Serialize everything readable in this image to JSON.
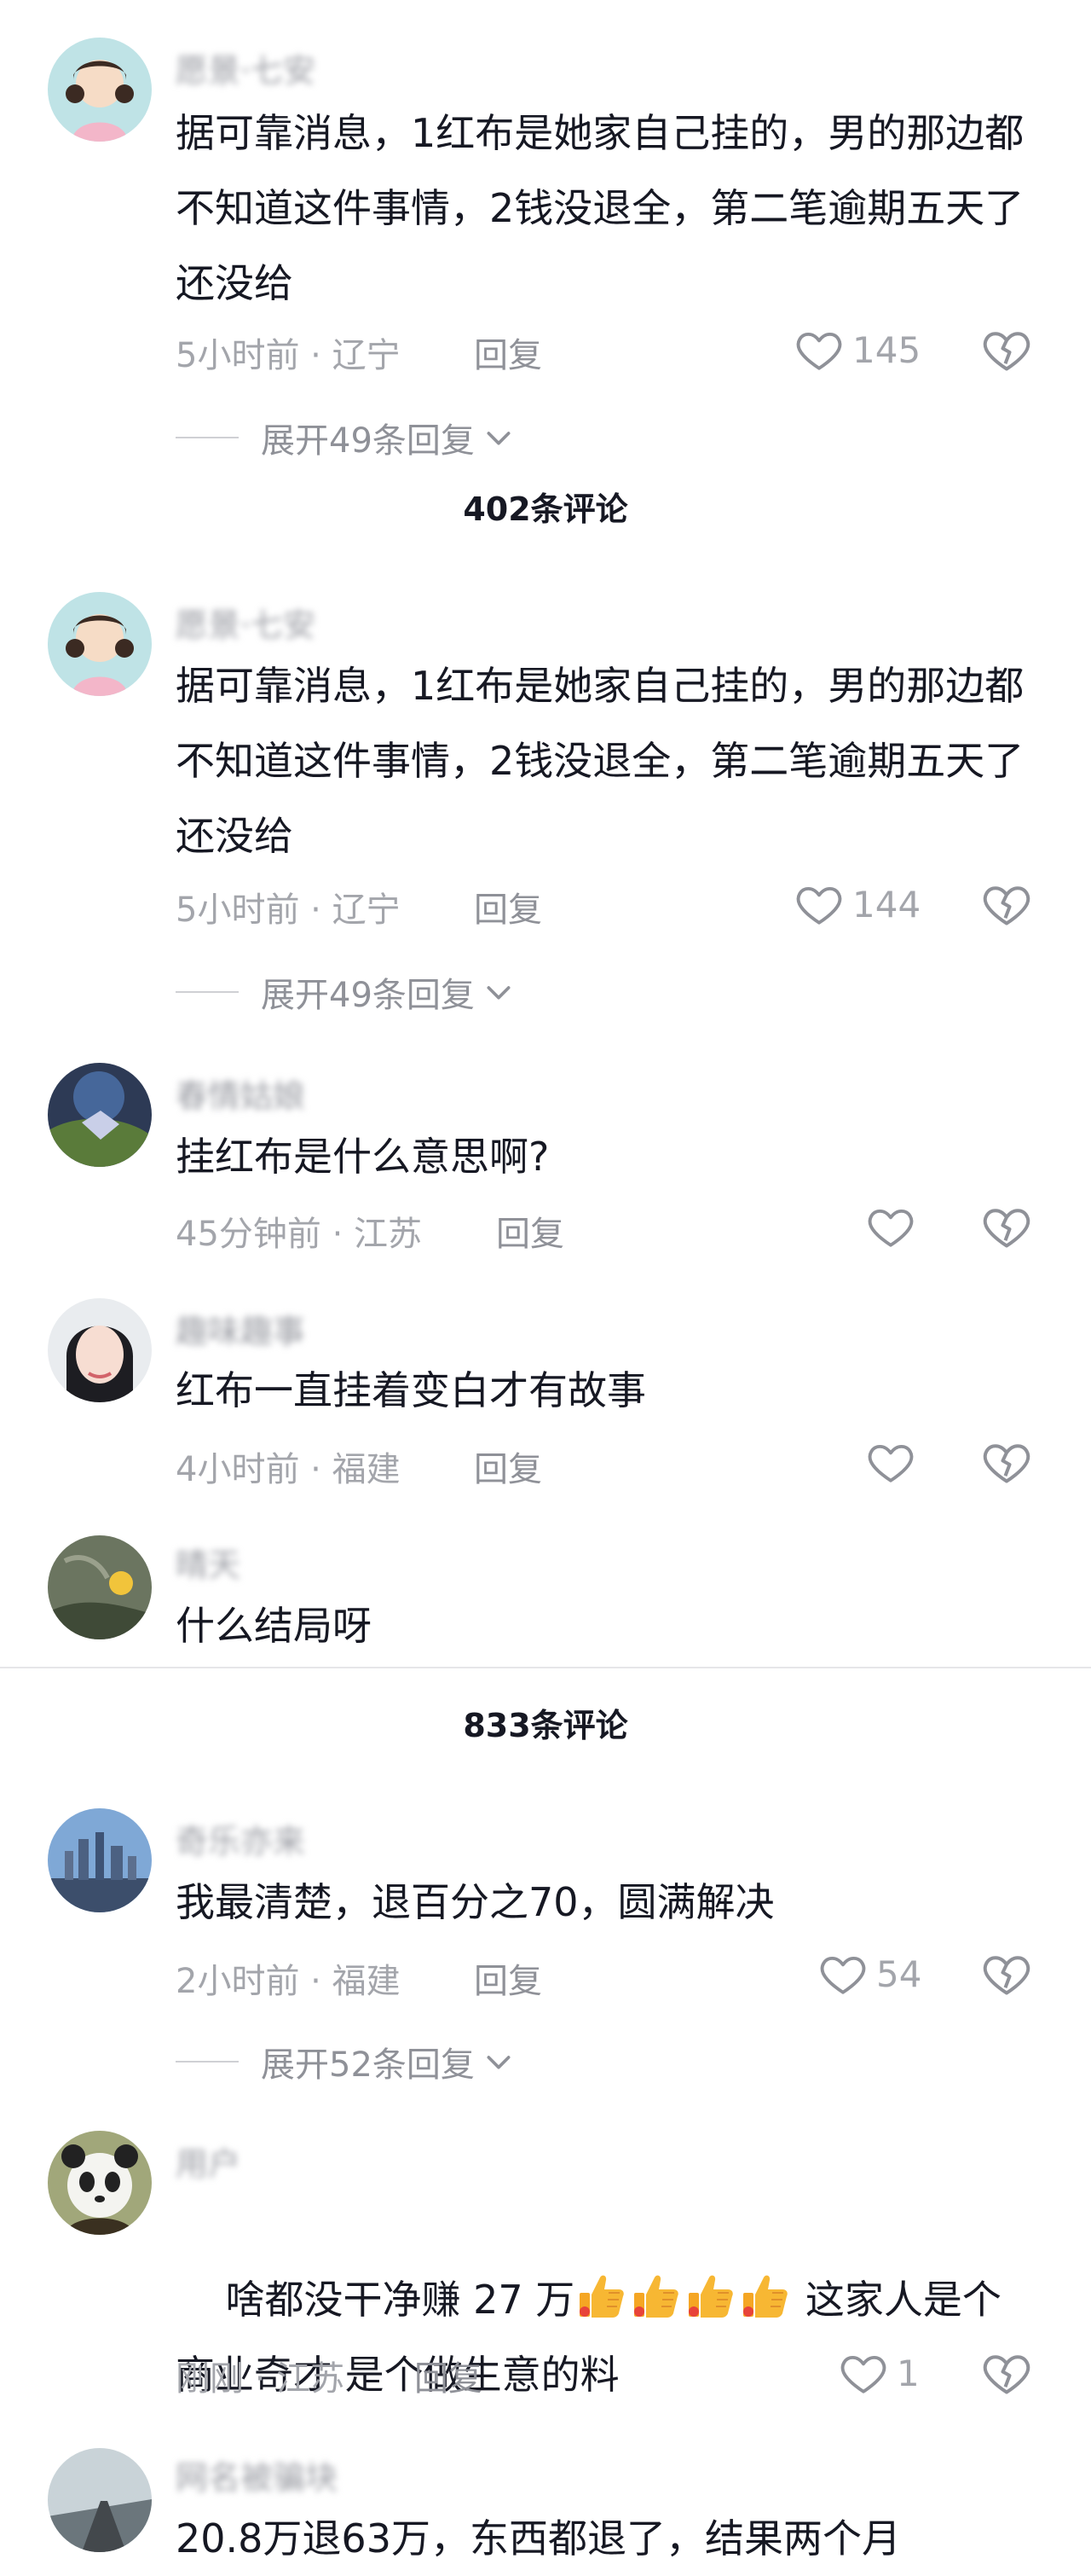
{
  "comment1": {
    "username": "愿景·七安",
    "text": "据可靠消息，1红布是她家自己挂的，男的那边都不知道这件事情，2钱没退全，第二笔逾期五天了还没给",
    "meta": "5小时前 · 辽宁",
    "reply": "回复",
    "likes": "145",
    "expand": "展开49条回复"
  },
  "section1": {
    "title": "402条评论"
  },
  "comment2": {
    "username": "愿景·七安",
    "text": "据可靠消息，1红布是她家自己挂的，男的那边都不知道这件事情，2钱没退全，第二笔逾期五天了还没给",
    "meta": "5小时前 · 辽宁",
    "reply": "回复",
    "likes": "144",
    "expand": "展开49条回复"
  },
  "comment3": {
    "username": "春情姑娘",
    "text": "挂红布是什么意思啊?",
    "meta": "45分钟前 · 江苏",
    "reply": "回复"
  },
  "comment4": {
    "username": "趣味趣事",
    "text": "红布一直挂着变白才有故事",
    "meta": "4小时前 · 福建",
    "reply": "回复"
  },
  "comment5": {
    "username": "晴天",
    "text": "什么结局呀"
  },
  "section2": {
    "title": "833条评论"
  },
  "comment6": {
    "username": "奇乐亦来",
    "text": "我最清楚，退百分之70，圆满解决",
    "meta": "2小时前 · 福建",
    "reply": "回复",
    "likes": "54",
    "expand": "展开52条回复"
  },
  "comment7": {
    "username": "用户",
    "text_line1_a": "啥都没干净赚 27 万",
    "text_line1_b": " 这家人是个",
    "text_line2": "商业奇才 是个做生意的料",
    "meta": "刚刚 · 江苏",
    "reply": "回复",
    "likes": "1"
  },
  "comment8": {
    "username": "网名被骗块",
    "text": "20.8万退63万，东西都退了，结果两个月"
  },
  "icons": {
    "like": "heart-outline-icon",
    "dislike": "broken-heart-icon",
    "expand": "chevron-down-icon"
  },
  "colors": {
    "text": "#161823",
    "secondary": "#a3a5ab",
    "divider": "#e6e6e8"
  }
}
